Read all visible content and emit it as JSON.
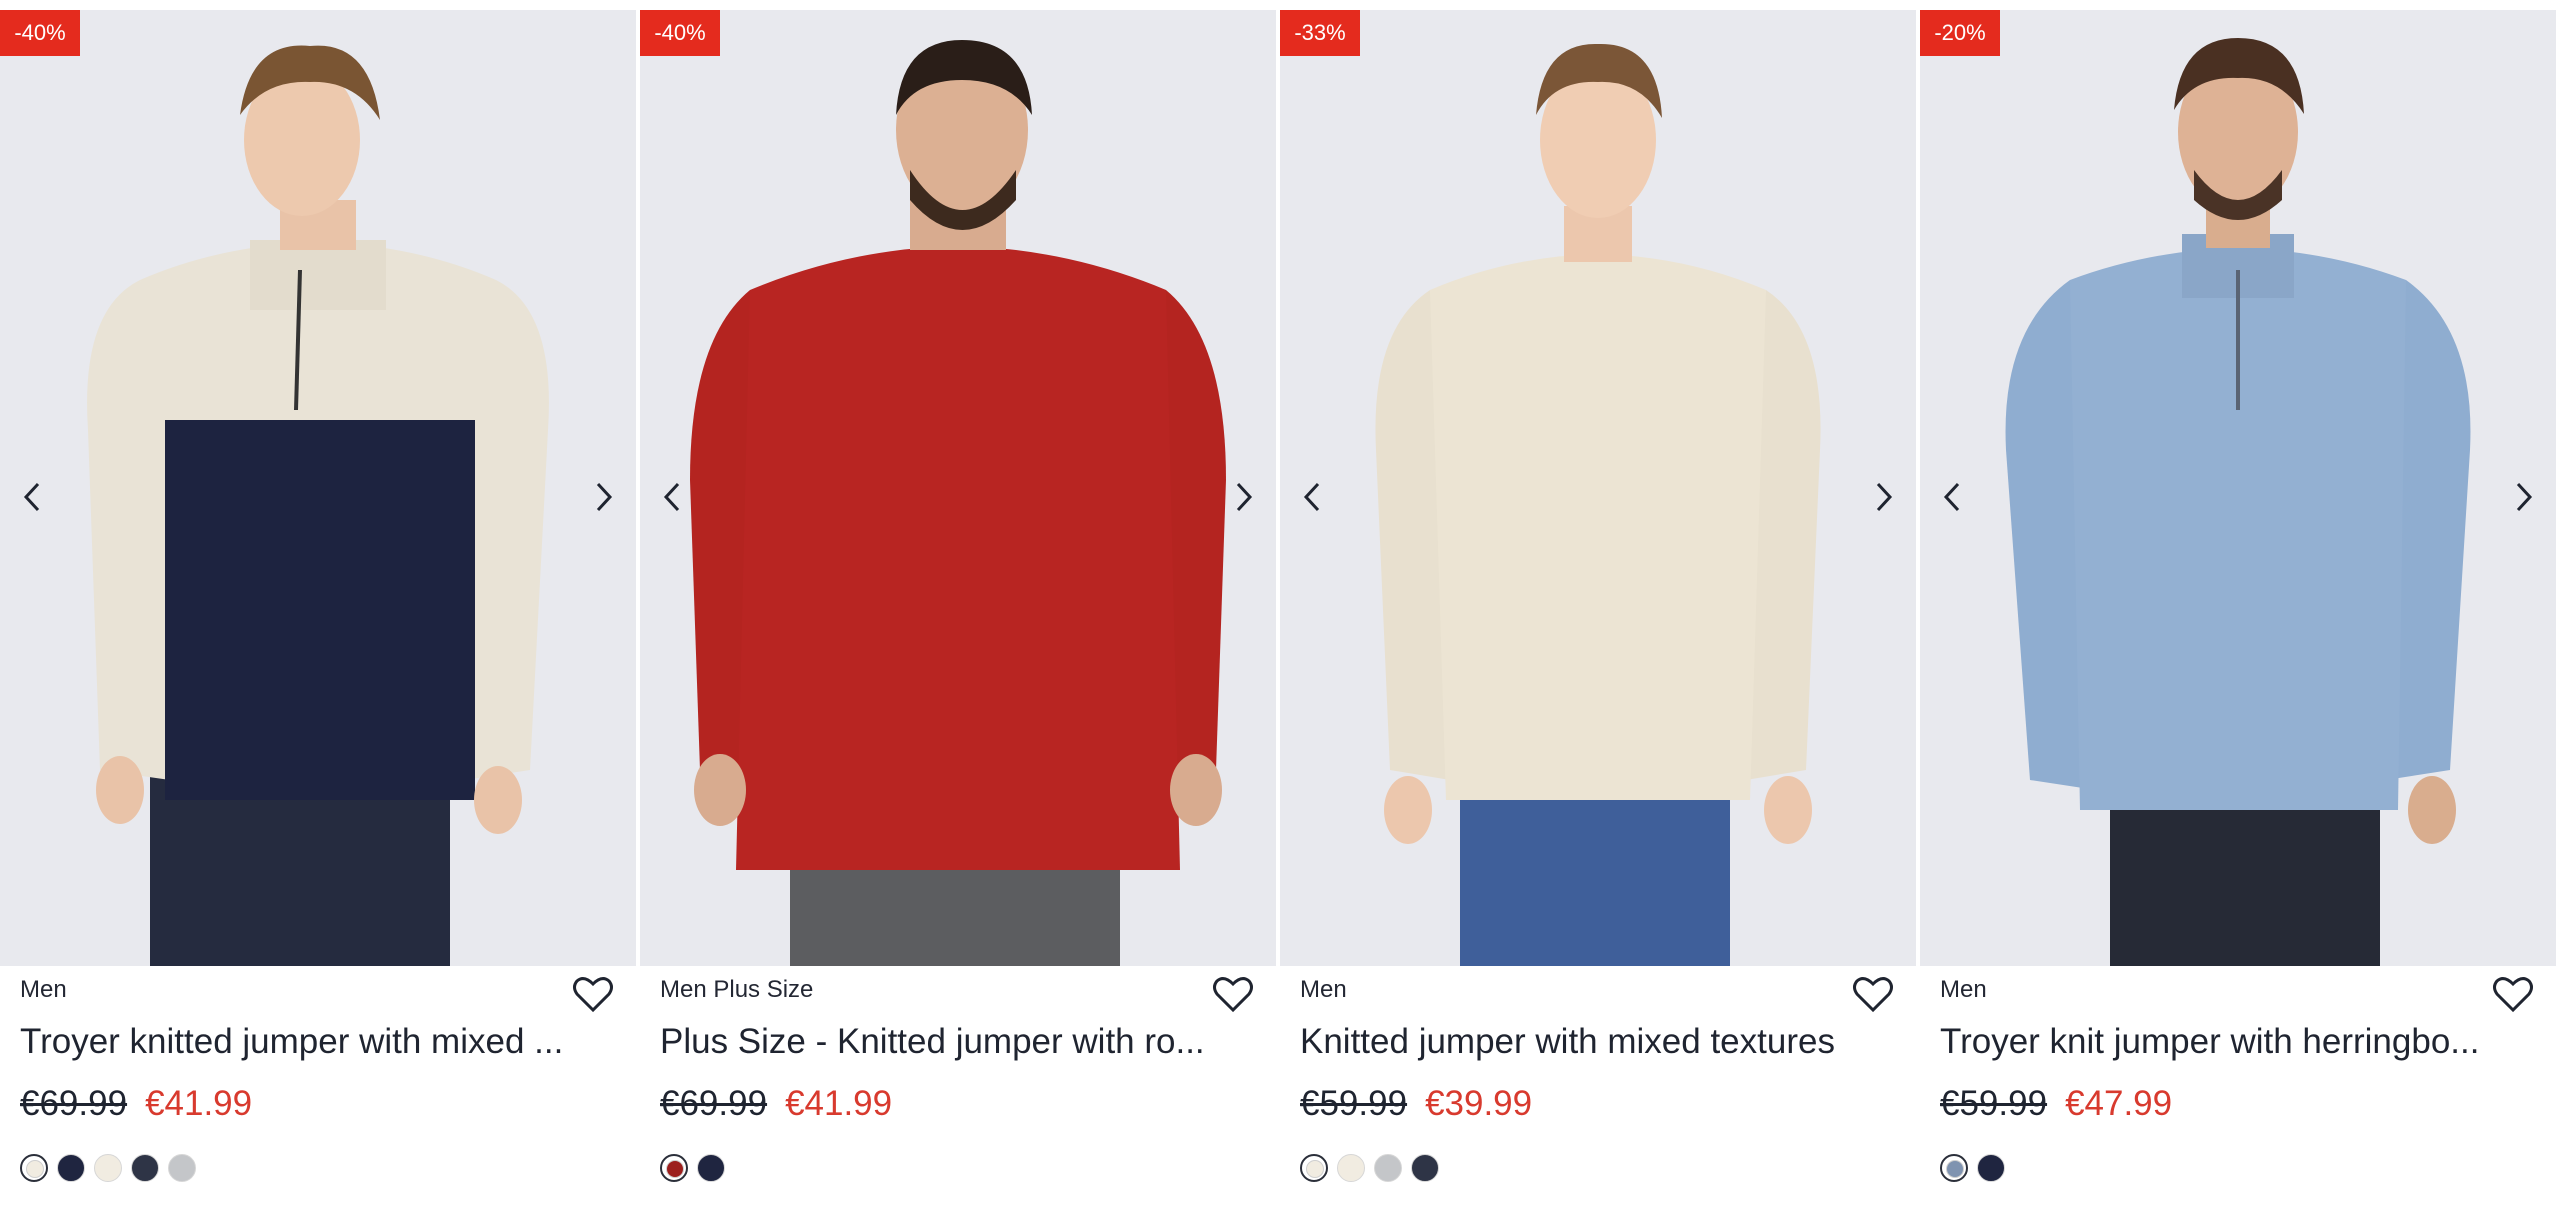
{
  "colors": {
    "badge": "#e42b1e",
    "sale_price": "#d83a2e",
    "image_bg": "#e8e9ee"
  },
  "products": [
    {
      "discount": "-40%",
      "category": "Men",
      "title": "Troyer knitted jumper with mixed ...",
      "old_price": "€69.99",
      "new_price": "€41.99",
      "garment": "troyer-two-tone",
      "swatches": [
        {
          "color": "#f1ece1",
          "selected": true
        },
        {
          "color": "#1f2540"
        },
        {
          "color": "#f1ece1"
        },
        {
          "color": "#2e3446"
        },
        {
          "color": "#c4c6c9"
        }
      ]
    },
    {
      "discount": "-40%",
      "category": "Men Plus Size",
      "title": "Plus Size - Knitted jumper with ro...",
      "old_price": "€69.99",
      "new_price": "€41.99",
      "garment": "red-knit",
      "swatches": [
        {
          "color": "#9c1f1d",
          "selected": true
        },
        {
          "color": "#1f2540"
        }
      ]
    },
    {
      "discount": "-33%",
      "category": "Men",
      "title": "Knitted jumper with mixed textures",
      "old_price": "€59.99",
      "new_price": "€39.99",
      "garment": "cream-knit",
      "swatches": [
        {
          "color": "#f1ece1",
          "selected": true
        },
        {
          "color": "#f1ece1"
        },
        {
          "color": "#c4c6c9"
        },
        {
          "color": "#2e3446"
        }
      ]
    },
    {
      "discount": "-20%",
      "category": "Men",
      "title": "Troyer knit jumper with herringbo...",
      "old_price": "€59.99",
      "new_price": "€47.99",
      "garment": "blue-troyer",
      "swatches": [
        {
          "color": "#7f93b0",
          "selected": true
        },
        {
          "color": "#1f2540"
        }
      ]
    }
  ],
  "icons": {
    "prev": "chevron-left-icon",
    "next": "chevron-right-icon",
    "wishlist": "heart-outline-icon"
  }
}
